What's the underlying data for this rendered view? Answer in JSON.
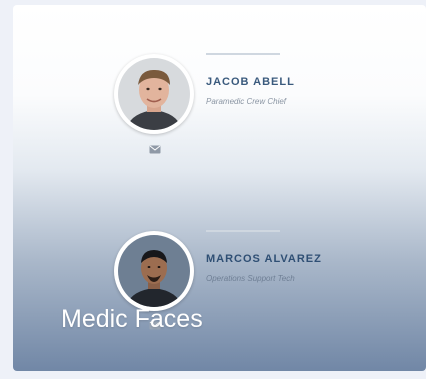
{
  "card": {
    "title": "Medic Faces",
    "members": [
      {
        "name": "JACOB ABELL",
        "role": "Paramedic Crew Chief",
        "icon": "mail-icon"
      },
      {
        "name": "MARCOS ALVAREZ",
        "role": "Operations Support Tech",
        "icon": "mail-icon"
      }
    ]
  },
  "colors": {
    "name": "#3a5a7d",
    "role": "#8a95a3",
    "gradient_bottom": "#7187a6"
  }
}
